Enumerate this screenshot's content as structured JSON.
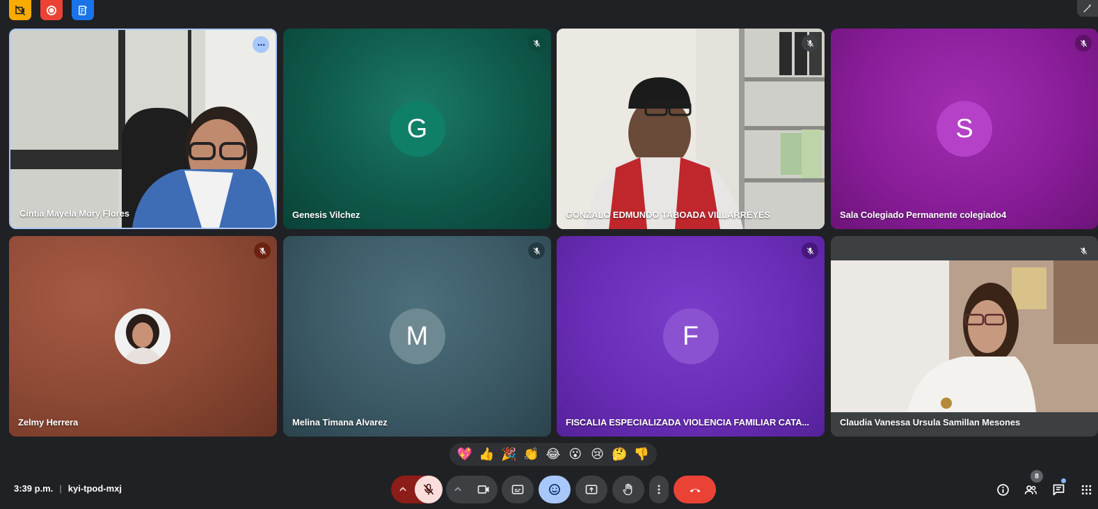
{
  "toolbar_top": {
    "icons": [
      "no-video-indicator-icon",
      "recording-icon",
      "notes-icon",
      "magic-edit-icon"
    ],
    "colors": {
      "yellow": "#f9ab00",
      "red": "#ea4335",
      "blue": "#1a73e8"
    }
  },
  "participants": [
    {
      "name": "Cintia Mayela Mory Flores",
      "type": "video",
      "muted": false
    },
    {
      "name": "Genesis Vilchez",
      "type": "avatar",
      "letter": "G",
      "avatar_color": "#0f7f68",
      "muted": true
    },
    {
      "name": "GONZALO EDMUNDO TABOADA VILLARREYES",
      "type": "video",
      "muted": true
    },
    {
      "name": "Sala Colegiado Permanente colegiado4",
      "type": "avatar",
      "letter": "S",
      "avatar_color": "#b541c9",
      "muted": true
    },
    {
      "name": "Zelmy Herrera",
      "type": "photo",
      "muted": true
    },
    {
      "name": "Melina Timana Alvarez",
      "type": "avatar",
      "letter": "M",
      "avatar_color": "#6f8993",
      "muted": true
    },
    {
      "name": "FISCALIA ESPECIALIZADA VIOLENCIA FAMILIAR CATA...",
      "type": "avatar",
      "letter": "F",
      "avatar_color": "#8a52d1",
      "muted": true
    },
    {
      "name": "Claudia Vanessa Ursula Samillan Mesones",
      "type": "video",
      "muted": true
    }
  ],
  "reactions": [
    "💖",
    "👍",
    "🎉",
    "👏",
    "😂",
    "😮",
    "😢",
    "🤔",
    "👎"
  ],
  "meeting": {
    "time": "3:39 p.m.",
    "separator": "|",
    "code": "kyi-tpod-mxj"
  },
  "people_count": "8"
}
